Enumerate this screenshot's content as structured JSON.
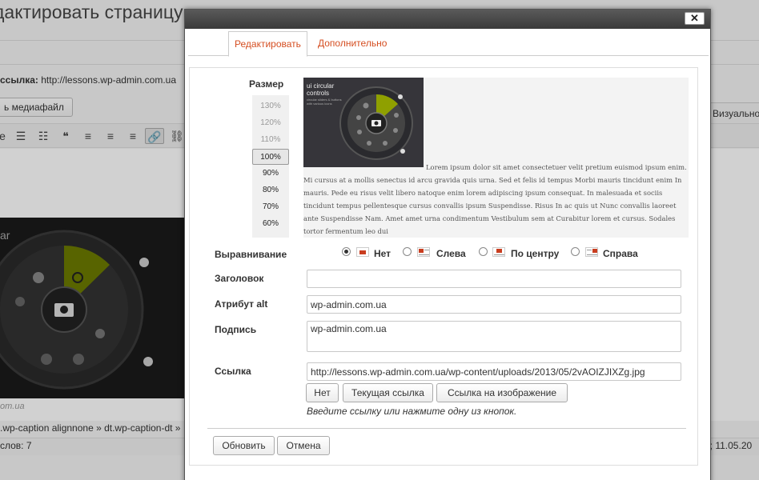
{
  "background": {
    "page_title": "дактировать страницу",
    "permalink_label": "ссылка:",
    "permalink_url": "http://lessons.wp-admin.com.ua",
    "add_media": "ь медиафайл",
    "visual_tab": "Визуально",
    "toolbar": [
      {
        "name": "italic-partial",
        "glyph": "е"
      },
      {
        "name": "bullet-list-icon",
        "glyph": "☰"
      },
      {
        "name": "numbered-list-icon",
        "glyph": "☷"
      },
      {
        "name": "quote-icon",
        "glyph": "❝"
      },
      {
        "name": "align-left-icon",
        "glyph": "≡"
      },
      {
        "name": "align-center-icon",
        "glyph": "≡"
      },
      {
        "name": "align-right-icon",
        "glyph": "≡"
      },
      {
        "name": "insert-link-icon",
        "glyph": "🔗"
      },
      {
        "name": "unlink-icon",
        "glyph": "⛓"
      }
    ],
    "image_caption": "om.ua",
    "element_path": ".wp-caption alignnone » dt.wp-caption-dt »",
    "word_count": "слов: 7",
    "last_edited": "n; 11.05.20",
    "thumb_partial_text": "ar"
  },
  "dialog": {
    "close_glyph": "✕",
    "tabs": [
      {
        "label": "Редактировать",
        "active": true
      },
      {
        "label": "Дополнительно",
        "active": false
      }
    ],
    "size_label": "Размер",
    "sizes": [
      {
        "label": "130%",
        "state": "dim"
      },
      {
        "label": "120%",
        "state": "dim"
      },
      {
        "label": "110%",
        "state": "dim"
      },
      {
        "label": "100%",
        "state": "selected"
      },
      {
        "label": "90%",
        "state": "normal"
      },
      {
        "label": "80%",
        "state": "normal"
      },
      {
        "label": "70%",
        "state": "normal"
      },
      {
        "label": "60%",
        "state": "normal"
      }
    ],
    "preview_image": {
      "title": "ui circular\ncontrols",
      "subtitle": "circular sliders & buttons with various icons"
    },
    "lorem": "Lorem ipsum dolor sit amet consectetuer velit pretium euismod ipsum enim. Mi cursus at a mollis senectus id arcu gravida quis urna. Sed et felis id tempus Morbi mauris tincidunt enim In mauris. Pede eu risus velit libero natoque enim lorem adipiscing ipsum consequat. In malesuada et sociis tincidunt tempus pellentesque cursus convallis ipsum Suspendisse. Risus In ac quis ut Nunc convallis laoreet ante Suspendisse Nam. Amet amet urna condimentum Vestibulum sem at Curabitur lorem et cursus. Sodales tortor fermentum leo dui",
    "alignment_label": "Выравнивание",
    "alignment_options": [
      {
        "label": "Нет",
        "checked": true,
        "icon": "align-none-icon"
      },
      {
        "label": "Слева",
        "checked": false,
        "icon": "align-left-icon"
      },
      {
        "label": "По центру",
        "checked": false,
        "icon": "align-center-icon"
      },
      {
        "label": "Справа",
        "checked": false,
        "icon": "align-right-icon"
      }
    ],
    "title_label": "Заголовок",
    "title_value": "",
    "alt_label": "Атрибут alt",
    "alt_value": "wp-admin.com.ua",
    "caption_label": "Подпись",
    "caption_value": "wp-admin.com.ua",
    "link_label": "Ссылка",
    "link_value": "http://lessons.wp-admin.com.ua/wp-content/uploads/2013/05/2vAOIZJIXZg.jpg",
    "link_buttons": [
      "Нет",
      "Текущая ссылка",
      "Ссылка на изображение"
    ],
    "link_hint": "Введите ссылку или нажмите одну из кнопок.",
    "update_button": "Обновить",
    "cancel_button": "Отмена"
  }
}
